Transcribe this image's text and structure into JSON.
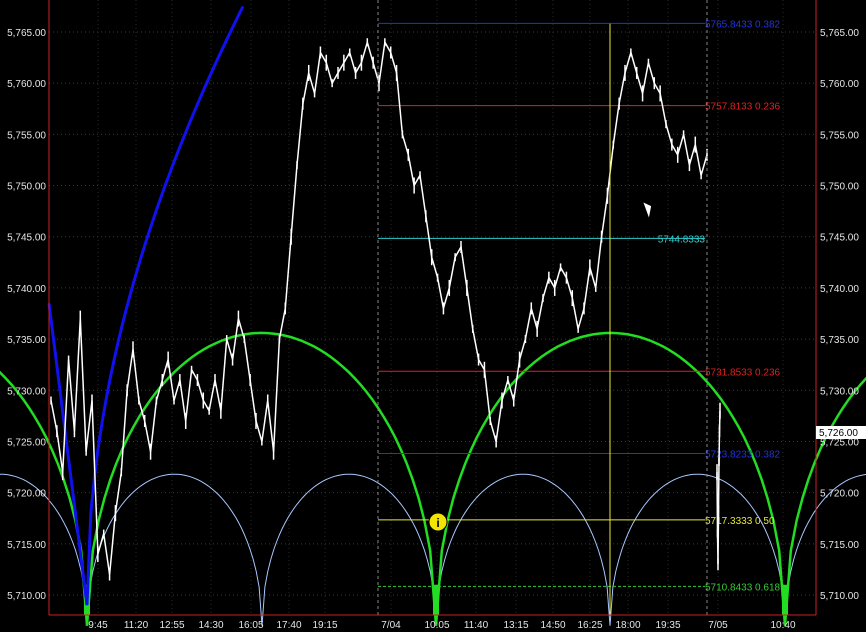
{
  "chart_data": {
    "type": "line",
    "ylim": [
      5708,
      5768
    ],
    "y_ticks": [
      {
        "value": 5765,
        "label": "5,765.00"
      },
      {
        "value": 5760,
        "label": "5,760.00"
      },
      {
        "value": 5755,
        "label": "5,755.00"
      },
      {
        "value": 5750,
        "label": "5,750.00"
      },
      {
        "value": 5745,
        "label": "5,745.00"
      },
      {
        "value": 5740,
        "label": "5,740.00"
      },
      {
        "value": 5735,
        "label": "5,735.00"
      },
      {
        "value": 5730,
        "label": "5,730.00"
      },
      {
        "value": 5725,
        "label": "5,725.00"
      },
      {
        "value": 5720,
        "label": "5,720.00"
      },
      {
        "value": 5715,
        "label": "5,715.00"
      },
      {
        "value": 5710,
        "label": "5,710.00"
      }
    ],
    "x_ticks": [
      "9:45",
      "11:20",
      "12:55",
      "14:30",
      "16:05",
      "17:40",
      "19:15",
      "7/04",
      "10:05",
      "11:40",
      "13:15",
      "14:50",
      "16:25",
      "18:00",
      "19:35",
      "7/05",
      "10:40"
    ],
    "last_price": {
      "label": "5,726.00",
      "value": 5726
    },
    "levels": [
      {
        "label": "5765.8433 0.382",
        "value": 5765.8433,
        "color": "#2233dd"
      },
      {
        "label": "5757.8133 0.236",
        "value": 5757.8133,
        "color": "#dd2222"
      },
      {
        "label": "5744.8333",
        "value": 5744.8333,
        "color": "#33cccc"
      },
      {
        "label": "5731.8533 0.236",
        "value": 5731.8533,
        "color": "#dd2222"
      },
      {
        "label": "5723.8233 0.382",
        "value": 5723.8233,
        "color": "#2233dd"
      },
      {
        "label": "5717.3333 0.50",
        "value": 5717.3333,
        "color": "#e8e833"
      },
      {
        "label": "5710.8433 0.618",
        "value": 5710.8433,
        "color": "#33cc33"
      }
    ],
    "price_series": [
      5729,
      5726,
      5722,
      5733,
      5726,
      5737,
      5724,
      5729,
      5714,
      5716,
      5712,
      5718,
      5722,
      5730,
      5734,
      5729,
      5727,
      5724,
      5729,
      5731,
      5733,
      5729,
      5731,
      5727,
      5732,
      5731,
      5729,
      5728,
      5731,
      5728,
      5735,
      5733,
      5737,
      5735,
      5731,
      5727,
      5725,
      5729,
      5724,
      5735,
      5738,
      5745,
      5752,
      5758,
      5761,
      5759,
      5763,
      5762,
      5760,
      5761,
      5762,
      5763,
      5761,
      5762,
      5764,
      5762,
      5760,
      5764,
      5763,
      5761,
      5755,
      5753,
      5750,
      5751,
      5747,
      5743,
      5741,
      5738,
      5740,
      5743,
      5744,
      5740,
      5736,
      5733,
      5732,
      5727,
      5725,
      5729,
      5731,
      5729,
      5733,
      5735,
      5738,
      5736,
      5739,
      5741,
      5740,
      5742,
      5741,
      5739,
      5736,
      5738,
      5742,
      5740,
      5745,
      5749,
      5754,
      5758,
      5761,
      5763,
      5761,
      5759,
      5762,
      5760,
      5759,
      5756,
      5754,
      5753,
      5755,
      5752,
      5754,
      5751,
      5753,
      5722,
      5716,
      5713,
      5718,
      5723,
      5726,
      5728
    ],
    "price_x_range": [
      51,
      720
    ],
    "gap_after_index": 112,
    "gap_x": [
      707,
      717
    ]
  }
}
